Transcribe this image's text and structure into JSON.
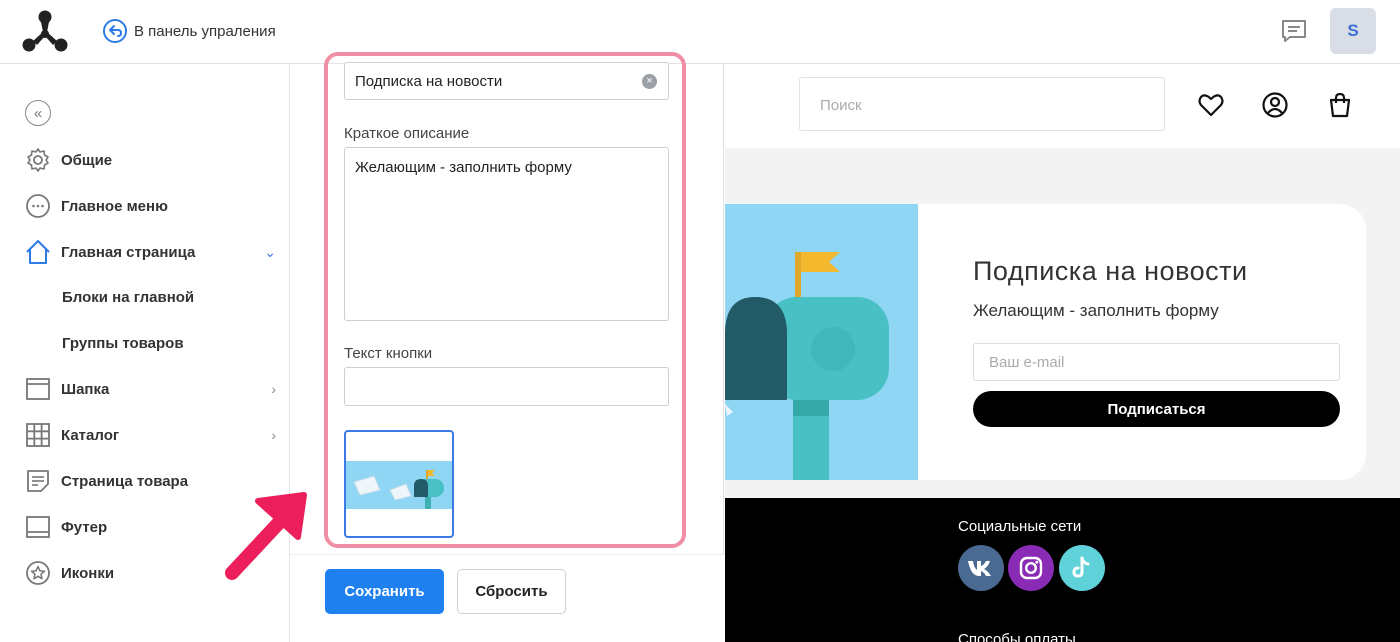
{
  "header": {
    "back_label": "В панель упраления",
    "avatar_letter": "S"
  },
  "sidebar": {
    "items": [
      {
        "label": "Общие",
        "icon": "gear-icon"
      },
      {
        "label": "Главное меню",
        "icon": "ellipsis-circle-icon"
      },
      {
        "label": "Главная страница",
        "icon": "home-icon"
      },
      {
        "label": "Блоки на главной"
      },
      {
        "label": "Группы товаров"
      },
      {
        "label": "Шапка",
        "icon": "header-layout-icon"
      },
      {
        "label": "Каталог",
        "icon": "grid-icon"
      },
      {
        "label": "Страница товара",
        "icon": "document-icon"
      },
      {
        "label": "Футер",
        "icon": "footer-layout-icon"
      },
      {
        "label": "Иконки",
        "icon": "star-circle-icon"
      }
    ]
  },
  "editor": {
    "title_value": "Подписка на новости",
    "desc_label": "Краткое описание",
    "desc_value": "Желающим - заполнить форму",
    "button_text_label": "Текст кнопки",
    "button_text_value": "",
    "save_label": "Сохранить",
    "reset_label": "Сбросить",
    "accent_color": "#1f80f0",
    "highlight_color": "#ef8ea4"
  },
  "preview": {
    "search_placeholder": "Поиск",
    "title": "Подписка на новости",
    "desc": "Желающим - заполнить форму",
    "email_placeholder": "Ваш e-mail",
    "subscribe_label": "Подписаться",
    "social_title": "Социальные сети",
    "payment_title": "Способы оплаты",
    "social": [
      "VK",
      "Instagram",
      "TikTok"
    ]
  }
}
